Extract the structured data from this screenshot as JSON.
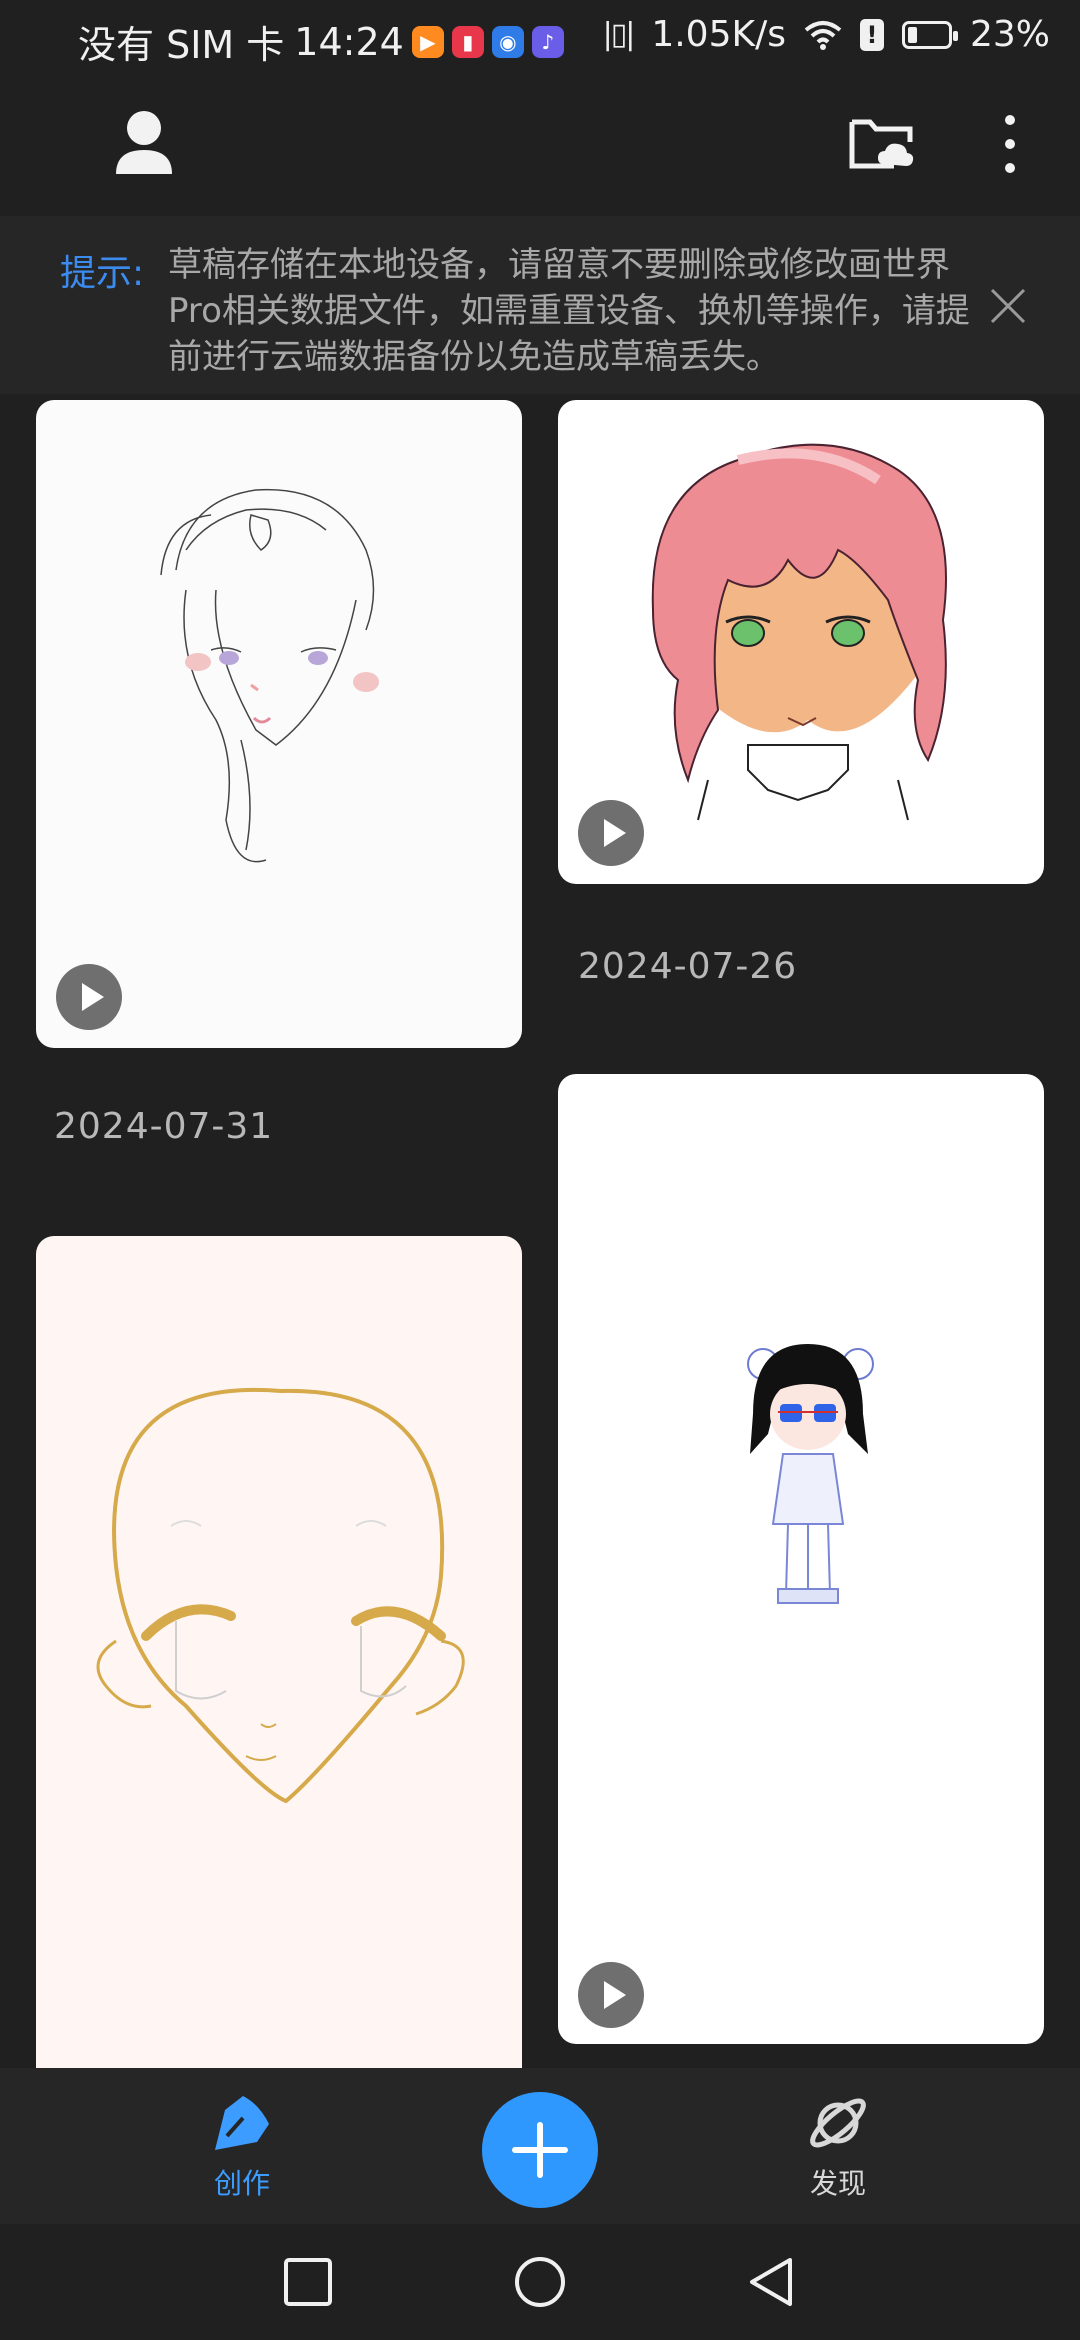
{
  "status_bar": {
    "carrier": "没有 SIM 卡",
    "time": "14:24",
    "network_speed": "1.05K/s",
    "battery_percent_label": "23%",
    "battery_level": 0.23,
    "notification_icons": [
      "video-app-icon",
      "book-app-icon",
      "browser-app-icon",
      "music-app-icon"
    ]
  },
  "app_bar": {
    "icons": [
      "user-icon",
      "cloud-folder-icon",
      "more-vert-icon"
    ]
  },
  "tip": {
    "label": "提示:",
    "text": "草稿存储在本地设备，请留意不要删除或修改画世界Pro相关数据文件，如需重置设备、换机等操作，请提前进行云端数据备份以免造成草稿丢失。"
  },
  "drafts": [
    {
      "id": "sketch-boy",
      "date": "",
      "has_replay": true
    },
    {
      "id": "pink-hair",
      "date": "2024-07-26",
      "has_replay": true
    },
    {
      "id": "chibi-girl",
      "date": "",
      "has_replay": true
    },
    {
      "id": "face-base",
      "date": "",
      "has_replay": false
    }
  ],
  "date_labels": {
    "left_first": "2024-07-31",
    "right_first": "2024-07-26"
  },
  "bottom_nav": {
    "create_label": "创作",
    "discover_label": "发现",
    "active": "create"
  },
  "colors": {
    "accent": "#2f98ff",
    "background": "#202020",
    "tip_label": "#3c8cf0"
  }
}
